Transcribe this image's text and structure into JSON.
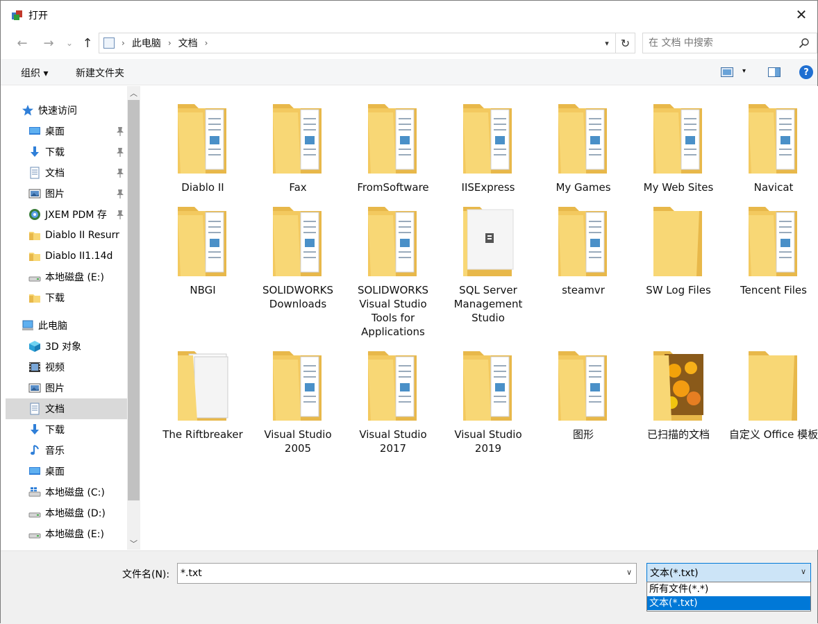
{
  "window": {
    "title": "打开",
    "close_glyph": "✕"
  },
  "address": {
    "back": "←",
    "forward": "→",
    "recent": "⌄",
    "up": "↑",
    "crumbs": [
      "此电脑",
      "文档"
    ],
    "refresh": "↻"
  },
  "search": {
    "placeholder": "在 文档 中搜索"
  },
  "toolbar": {
    "organize": "组织 ▾",
    "new_folder": "新建文件夹",
    "help": "?"
  },
  "nav": {
    "items": [
      {
        "label": "快速访问",
        "icon": "star-icon",
        "pinned": false
      },
      {
        "label": "桌面",
        "icon": "desktop-icon",
        "pinned": true
      },
      {
        "label": "下载",
        "icon": "download-icon",
        "pinned": true
      },
      {
        "label": "文档",
        "icon": "document-icon",
        "pinned": true
      },
      {
        "label": "图片",
        "icon": "pictures-icon",
        "pinned": true
      },
      {
        "label": "JXEM PDM 存",
        "icon": "pdm-icon",
        "pinned": true
      },
      {
        "label": "Diablo II Resurr",
        "icon": "folder-icon",
        "pinned": false
      },
      {
        "label": "Diablo II1.14d",
        "icon": "folder-icon",
        "pinned": false
      },
      {
        "label": "本地磁盘 (E:)",
        "icon": "drive-icon",
        "pinned": false
      },
      {
        "label": "下载",
        "icon": "folder-icon",
        "pinned": false
      },
      {
        "label": "此电脑",
        "icon": "computer-icon",
        "pinned": false
      },
      {
        "label": "3D 对象",
        "icon": "cube-icon",
        "pinned": false
      },
      {
        "label": "视频",
        "icon": "video-icon",
        "pinned": false
      },
      {
        "label": "图片",
        "icon": "pictures-icon",
        "pinned": false
      },
      {
        "label": "文档",
        "icon": "document-icon",
        "pinned": false
      },
      {
        "label": "下载",
        "icon": "download-icon",
        "pinned": false
      },
      {
        "label": "音乐",
        "icon": "music-icon",
        "pinned": false
      },
      {
        "label": "桌面",
        "icon": "desktop-icon",
        "pinned": false
      },
      {
        "label": "本地磁盘 (C:)",
        "icon": "windows-drive-icon",
        "pinned": false
      },
      {
        "label": "本地磁盘 (D:)",
        "icon": "drive-icon",
        "pinned": false
      },
      {
        "label": "本地磁盘 (E:)",
        "icon": "drive-icon",
        "pinned": false
      }
    ],
    "selected_label": "文档"
  },
  "files": [
    {
      "label": "Diablo II",
      "kind": "folder-docs"
    },
    {
      "label": "Fax",
      "kind": "folder-docs"
    },
    {
      "label": "FromSoftware",
      "kind": "folder-docs"
    },
    {
      "label": "IISExpress",
      "kind": "folder-docs"
    },
    {
      "label": "My Games",
      "kind": "folder-docs"
    },
    {
      "label": "My Web Sites",
      "kind": "folder-docs"
    },
    {
      "label": "Navicat",
      "kind": "folder-docs"
    },
    {
      "label": "NBGI",
      "kind": "folder-docs"
    },
    {
      "label": "SOLIDWORKS Downloads",
      "kind": "folder-docs"
    },
    {
      "label": "SOLIDWORKS Visual Studio Tools for Applications",
      "kind": "folder-docs"
    },
    {
      "label": "SQL Server Management Studio",
      "kind": "folder-file"
    },
    {
      "label": "steamvr",
      "kind": "folder-docs"
    },
    {
      "label": "SW Log Files",
      "kind": "folder-empty"
    },
    {
      "label": "Tencent Files",
      "kind": "folder-docs"
    },
    {
      "label": "The Riftbreaker",
      "kind": "folder-papers"
    },
    {
      "label": "Visual Studio 2005",
      "kind": "folder-docs"
    },
    {
      "label": "Visual Studio 2017",
      "kind": "folder-docs"
    },
    {
      "label": "Visual Studio 2019",
      "kind": "folder-docs"
    },
    {
      "label": "图形",
      "kind": "folder-docs"
    },
    {
      "label": "已扫描的文档",
      "kind": "folder-photo"
    },
    {
      "label": "自定义 Office 模板",
      "kind": "folder-empty"
    }
  ],
  "bottom": {
    "filename_label": "文件名(N):",
    "filename_value": "*.txt",
    "filetype_selected": "文本(*.txt)",
    "filetype_options": [
      "所有文件(*.*)",
      "文本(*.txt)"
    ],
    "filetype_highlighted": "文本(*.txt)"
  },
  "colors": {
    "accent": "#0078d7",
    "folder": "#f8d775",
    "folder_dark": "#e8b84a",
    "selection": "#d9d9d9"
  }
}
